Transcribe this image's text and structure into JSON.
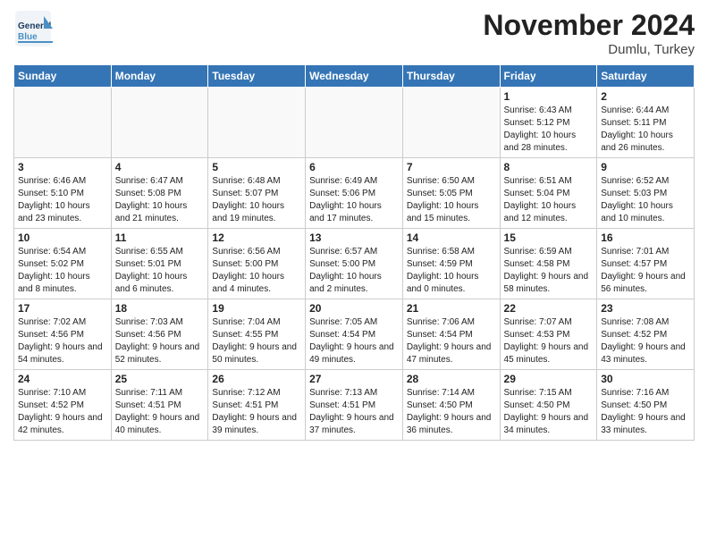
{
  "header": {
    "logo_general": "General",
    "logo_blue": "Blue",
    "month": "November 2024",
    "location": "Dumlu, Turkey"
  },
  "days_of_week": [
    "Sunday",
    "Monday",
    "Tuesday",
    "Wednesday",
    "Thursday",
    "Friday",
    "Saturday"
  ],
  "weeks": [
    [
      {
        "day": "",
        "info": ""
      },
      {
        "day": "",
        "info": ""
      },
      {
        "day": "",
        "info": ""
      },
      {
        "day": "",
        "info": ""
      },
      {
        "day": "",
        "info": ""
      },
      {
        "day": "1",
        "info": "Sunrise: 6:43 AM\nSunset: 5:12 PM\nDaylight: 10 hours and 28 minutes."
      },
      {
        "day": "2",
        "info": "Sunrise: 6:44 AM\nSunset: 5:11 PM\nDaylight: 10 hours and 26 minutes."
      }
    ],
    [
      {
        "day": "3",
        "info": "Sunrise: 6:46 AM\nSunset: 5:10 PM\nDaylight: 10 hours and 23 minutes."
      },
      {
        "day": "4",
        "info": "Sunrise: 6:47 AM\nSunset: 5:08 PM\nDaylight: 10 hours and 21 minutes."
      },
      {
        "day": "5",
        "info": "Sunrise: 6:48 AM\nSunset: 5:07 PM\nDaylight: 10 hours and 19 minutes."
      },
      {
        "day": "6",
        "info": "Sunrise: 6:49 AM\nSunset: 5:06 PM\nDaylight: 10 hours and 17 minutes."
      },
      {
        "day": "7",
        "info": "Sunrise: 6:50 AM\nSunset: 5:05 PM\nDaylight: 10 hours and 15 minutes."
      },
      {
        "day": "8",
        "info": "Sunrise: 6:51 AM\nSunset: 5:04 PM\nDaylight: 10 hours and 12 minutes."
      },
      {
        "day": "9",
        "info": "Sunrise: 6:52 AM\nSunset: 5:03 PM\nDaylight: 10 hours and 10 minutes."
      }
    ],
    [
      {
        "day": "10",
        "info": "Sunrise: 6:54 AM\nSunset: 5:02 PM\nDaylight: 10 hours and 8 minutes."
      },
      {
        "day": "11",
        "info": "Sunrise: 6:55 AM\nSunset: 5:01 PM\nDaylight: 10 hours and 6 minutes."
      },
      {
        "day": "12",
        "info": "Sunrise: 6:56 AM\nSunset: 5:00 PM\nDaylight: 10 hours and 4 minutes."
      },
      {
        "day": "13",
        "info": "Sunrise: 6:57 AM\nSunset: 5:00 PM\nDaylight: 10 hours and 2 minutes."
      },
      {
        "day": "14",
        "info": "Sunrise: 6:58 AM\nSunset: 4:59 PM\nDaylight: 10 hours and 0 minutes."
      },
      {
        "day": "15",
        "info": "Sunrise: 6:59 AM\nSunset: 4:58 PM\nDaylight: 9 hours and 58 minutes."
      },
      {
        "day": "16",
        "info": "Sunrise: 7:01 AM\nSunset: 4:57 PM\nDaylight: 9 hours and 56 minutes."
      }
    ],
    [
      {
        "day": "17",
        "info": "Sunrise: 7:02 AM\nSunset: 4:56 PM\nDaylight: 9 hours and 54 minutes."
      },
      {
        "day": "18",
        "info": "Sunrise: 7:03 AM\nSunset: 4:56 PM\nDaylight: 9 hours and 52 minutes."
      },
      {
        "day": "19",
        "info": "Sunrise: 7:04 AM\nSunset: 4:55 PM\nDaylight: 9 hours and 50 minutes."
      },
      {
        "day": "20",
        "info": "Sunrise: 7:05 AM\nSunset: 4:54 PM\nDaylight: 9 hours and 49 minutes."
      },
      {
        "day": "21",
        "info": "Sunrise: 7:06 AM\nSunset: 4:54 PM\nDaylight: 9 hours and 47 minutes."
      },
      {
        "day": "22",
        "info": "Sunrise: 7:07 AM\nSunset: 4:53 PM\nDaylight: 9 hours and 45 minutes."
      },
      {
        "day": "23",
        "info": "Sunrise: 7:08 AM\nSunset: 4:52 PM\nDaylight: 9 hours and 43 minutes."
      }
    ],
    [
      {
        "day": "24",
        "info": "Sunrise: 7:10 AM\nSunset: 4:52 PM\nDaylight: 9 hours and 42 minutes."
      },
      {
        "day": "25",
        "info": "Sunrise: 7:11 AM\nSunset: 4:51 PM\nDaylight: 9 hours and 40 minutes."
      },
      {
        "day": "26",
        "info": "Sunrise: 7:12 AM\nSunset: 4:51 PM\nDaylight: 9 hours and 39 minutes."
      },
      {
        "day": "27",
        "info": "Sunrise: 7:13 AM\nSunset: 4:51 PM\nDaylight: 9 hours and 37 minutes."
      },
      {
        "day": "28",
        "info": "Sunrise: 7:14 AM\nSunset: 4:50 PM\nDaylight: 9 hours and 36 minutes."
      },
      {
        "day": "29",
        "info": "Sunrise: 7:15 AM\nSunset: 4:50 PM\nDaylight: 9 hours and 34 minutes."
      },
      {
        "day": "30",
        "info": "Sunrise: 7:16 AM\nSunset: 4:50 PM\nDaylight: 9 hours and 33 minutes."
      }
    ]
  ]
}
